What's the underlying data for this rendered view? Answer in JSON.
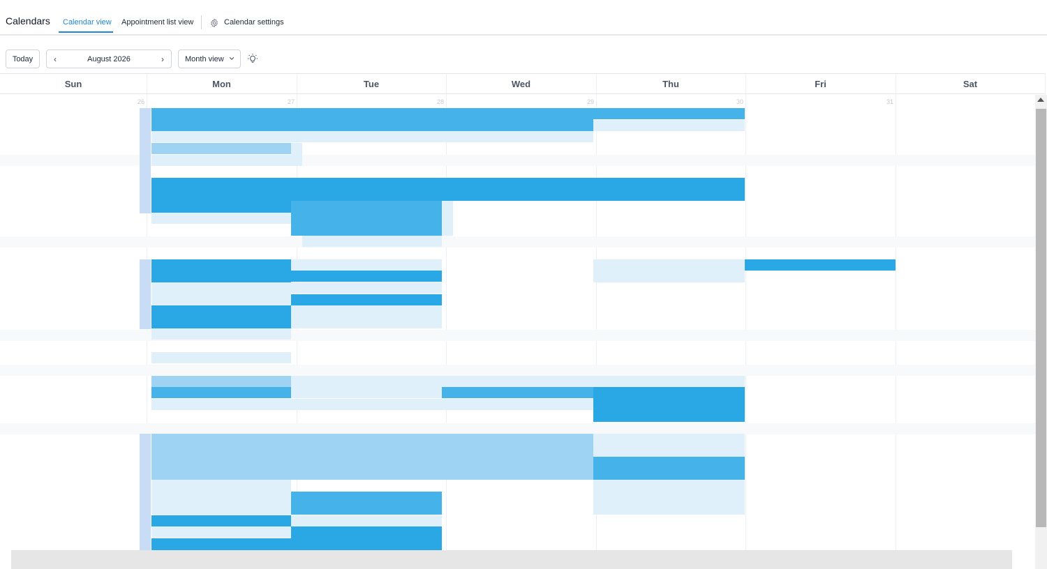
{
  "header": {
    "title": "Calendars",
    "tabs": {
      "calendar_view": "Calendar view",
      "appointment_list_view": "Appointment list view",
      "calendar_settings": "Calendar settings"
    }
  },
  "toolbar": {
    "today_label": "Today",
    "month_label": "August 2026",
    "view_label": "Month view"
  },
  "calendar": {
    "days": [
      "Sun",
      "Mon",
      "Tue",
      "Wed",
      "Thu",
      "Fri",
      "Sat"
    ],
    "dates": [
      "26",
      "27",
      "28",
      "29",
      "30",
      "31"
    ]
  },
  "colors": {
    "accent": "#1e88d6",
    "event_dark": "#2aa8e6",
    "event_light": "#dff0fb"
  },
  "icons": {
    "settings": "gear-icon",
    "prev": "chevron-left-icon",
    "next": "chevron-right-icon",
    "view_dropdown": "chevron-down-icon",
    "theme": "lightbulb-icon"
  }
}
